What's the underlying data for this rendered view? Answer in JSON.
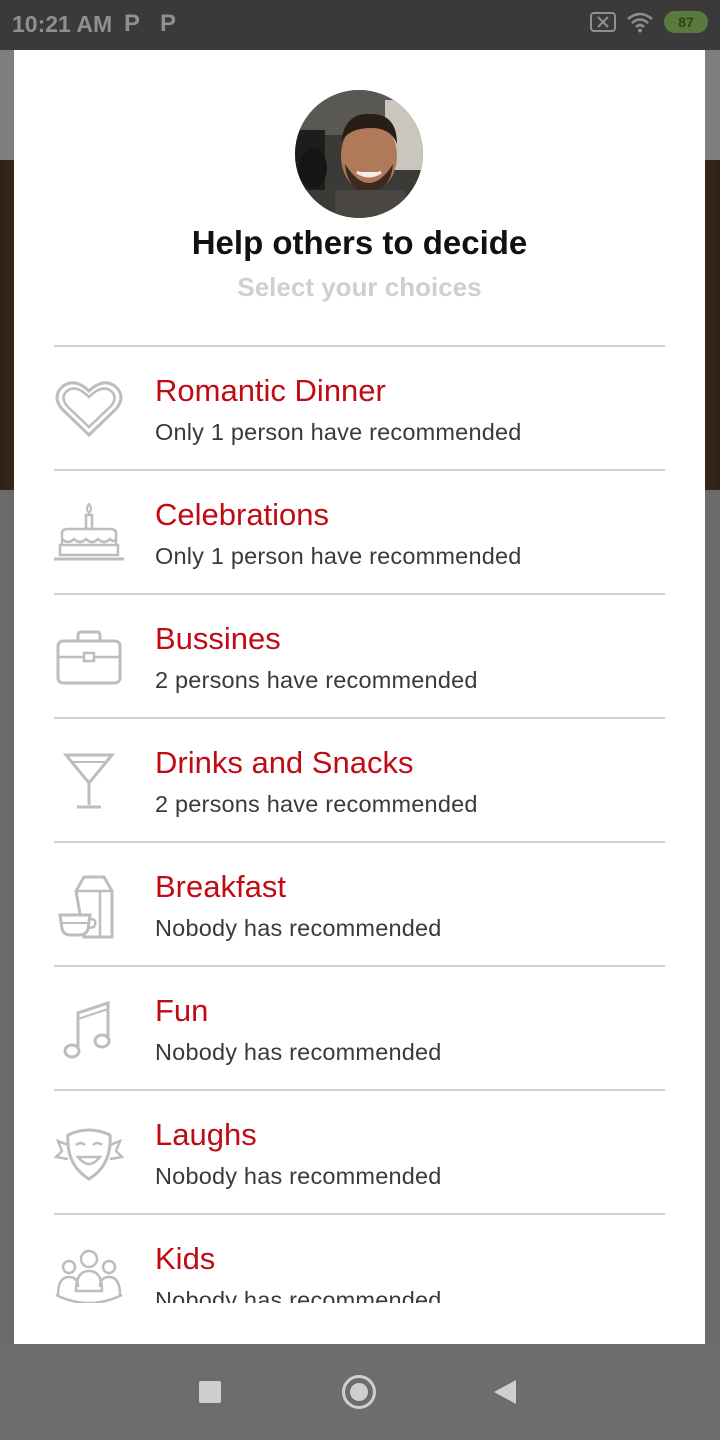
{
  "status_bar": {
    "time": "10:21 AM",
    "notif_icons": [
      "P",
      "P"
    ],
    "battery": "87"
  },
  "dialog": {
    "title": "Help others to decide",
    "subtitle": "Select your choices",
    "items": [
      {
        "icon": "heart-icon",
        "title": "Romantic Dinner",
        "subtitle": "Only 1 person have recommended"
      },
      {
        "icon": "cake-icon",
        "title": "Celebrations",
        "subtitle": "Only 1 person have recommended"
      },
      {
        "icon": "briefcase-icon",
        "title": "Bussines",
        "subtitle": "2 persons have recommended"
      },
      {
        "icon": "cocktail-icon",
        "title": "Drinks and Snacks",
        "subtitle": "2 persons have recommended"
      },
      {
        "icon": "breakfast-icon",
        "title": "Breakfast",
        "subtitle": "Nobody has recommended"
      },
      {
        "icon": "music-note-icon",
        "title": "Fun",
        "subtitle": "Nobody has recommended"
      },
      {
        "icon": "theater-mask-icon",
        "title": "Laughs",
        "subtitle": "Nobody has recommended"
      },
      {
        "icon": "family-icon",
        "title": "Kids",
        "subtitle": "Nobody has recommended"
      }
    ]
  },
  "colors": {
    "accent": "#c00b14",
    "subtitle_gray": "#cfcfcf",
    "text_dark": "#3a3a3a"
  }
}
